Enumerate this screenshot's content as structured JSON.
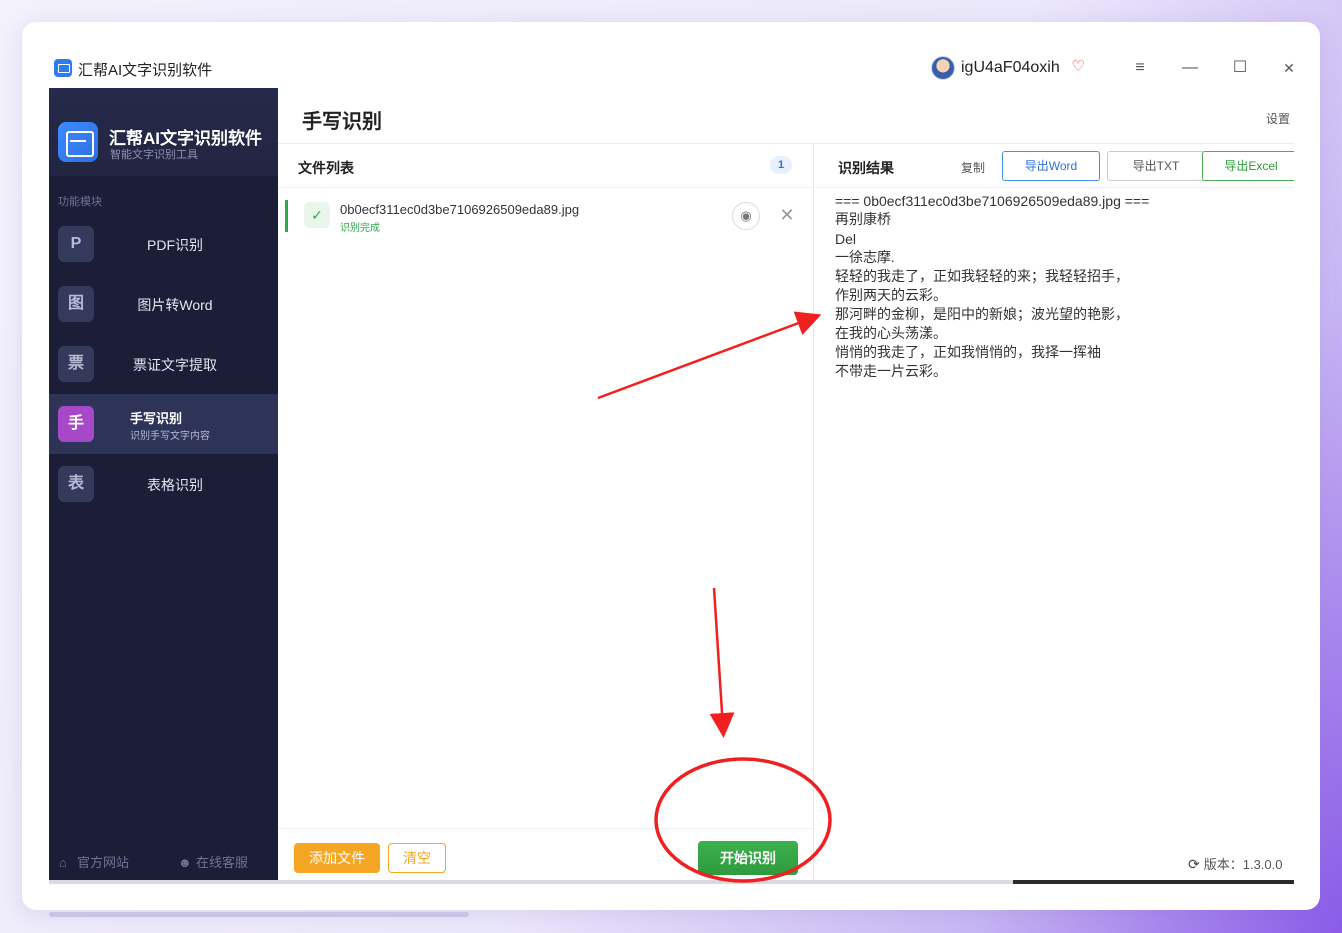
{
  "window": {
    "title": "汇帮AI文字识别软件",
    "username": "igU4aF04oxih",
    "controls": {
      "menu": "≡",
      "minimize": "—",
      "maximize": "☐",
      "close": "✕"
    }
  },
  "sidebar": {
    "brand_name": "汇帮AI文字识别软件",
    "brand_sub": "智能文字识别工具",
    "section_label": "功能模块",
    "items": [
      {
        "badge": "P",
        "label": "PDF识别"
      },
      {
        "badge": "图",
        "label": "图片转Word"
      },
      {
        "badge": "票",
        "label": "票证文字提取"
      },
      {
        "badge": "手",
        "label": "手写识别",
        "desc": "识别手写文字内容"
      },
      {
        "badge": "表",
        "label": "表格识别"
      }
    ],
    "footer": {
      "home": "官方网站",
      "support": "在线客服"
    }
  },
  "main": {
    "page_title": "手写识别",
    "settings": "设置"
  },
  "file_panel": {
    "title": "文件列表",
    "count": "1",
    "files": [
      {
        "name": "0b0ecf311ec0d3be7106926509eda89.jpg",
        "status": "识别完成"
      }
    ],
    "buttons": {
      "add": "添加文件",
      "clear": "清空",
      "start": "开始识别"
    }
  },
  "result_panel": {
    "title": "识别结果",
    "copy": "复制",
    "export_word": "导出Word",
    "export_txt": "导出TXT",
    "export_excel": "导出Excel",
    "lines": [
      "=== 0b0ecf311ec0d3be7106926509eda89.jpg ===",
      "再别康桥",
      "Del",
      "一徐志摩.",
      "轻轻的我走了，正如我轻轻的来；我轻轻招手，",
      "作别两天的云彩。",
      "那河畔的金柳，是阳中的新娘；波光望的艳影，",
      "在我的心头荡漾。",
      "悄悄的我走了，正如我悄悄的，我择一挥袖",
      "不带走一片云彩。"
    ],
    "version": "版本：1.3.0.0"
  },
  "icons": {
    "check": "✓",
    "eye": "◉",
    "remove": "✕",
    "refresh": "⟳",
    "home": "⌂",
    "support": "☻",
    "vip": "♡"
  },
  "colors": {
    "accent_blue": "#2d6fe0",
    "success_green": "#2fa84f",
    "warning_orange": "#f5a623",
    "active_purple": "#a648c8",
    "annotation_red": "#f02020"
  }
}
